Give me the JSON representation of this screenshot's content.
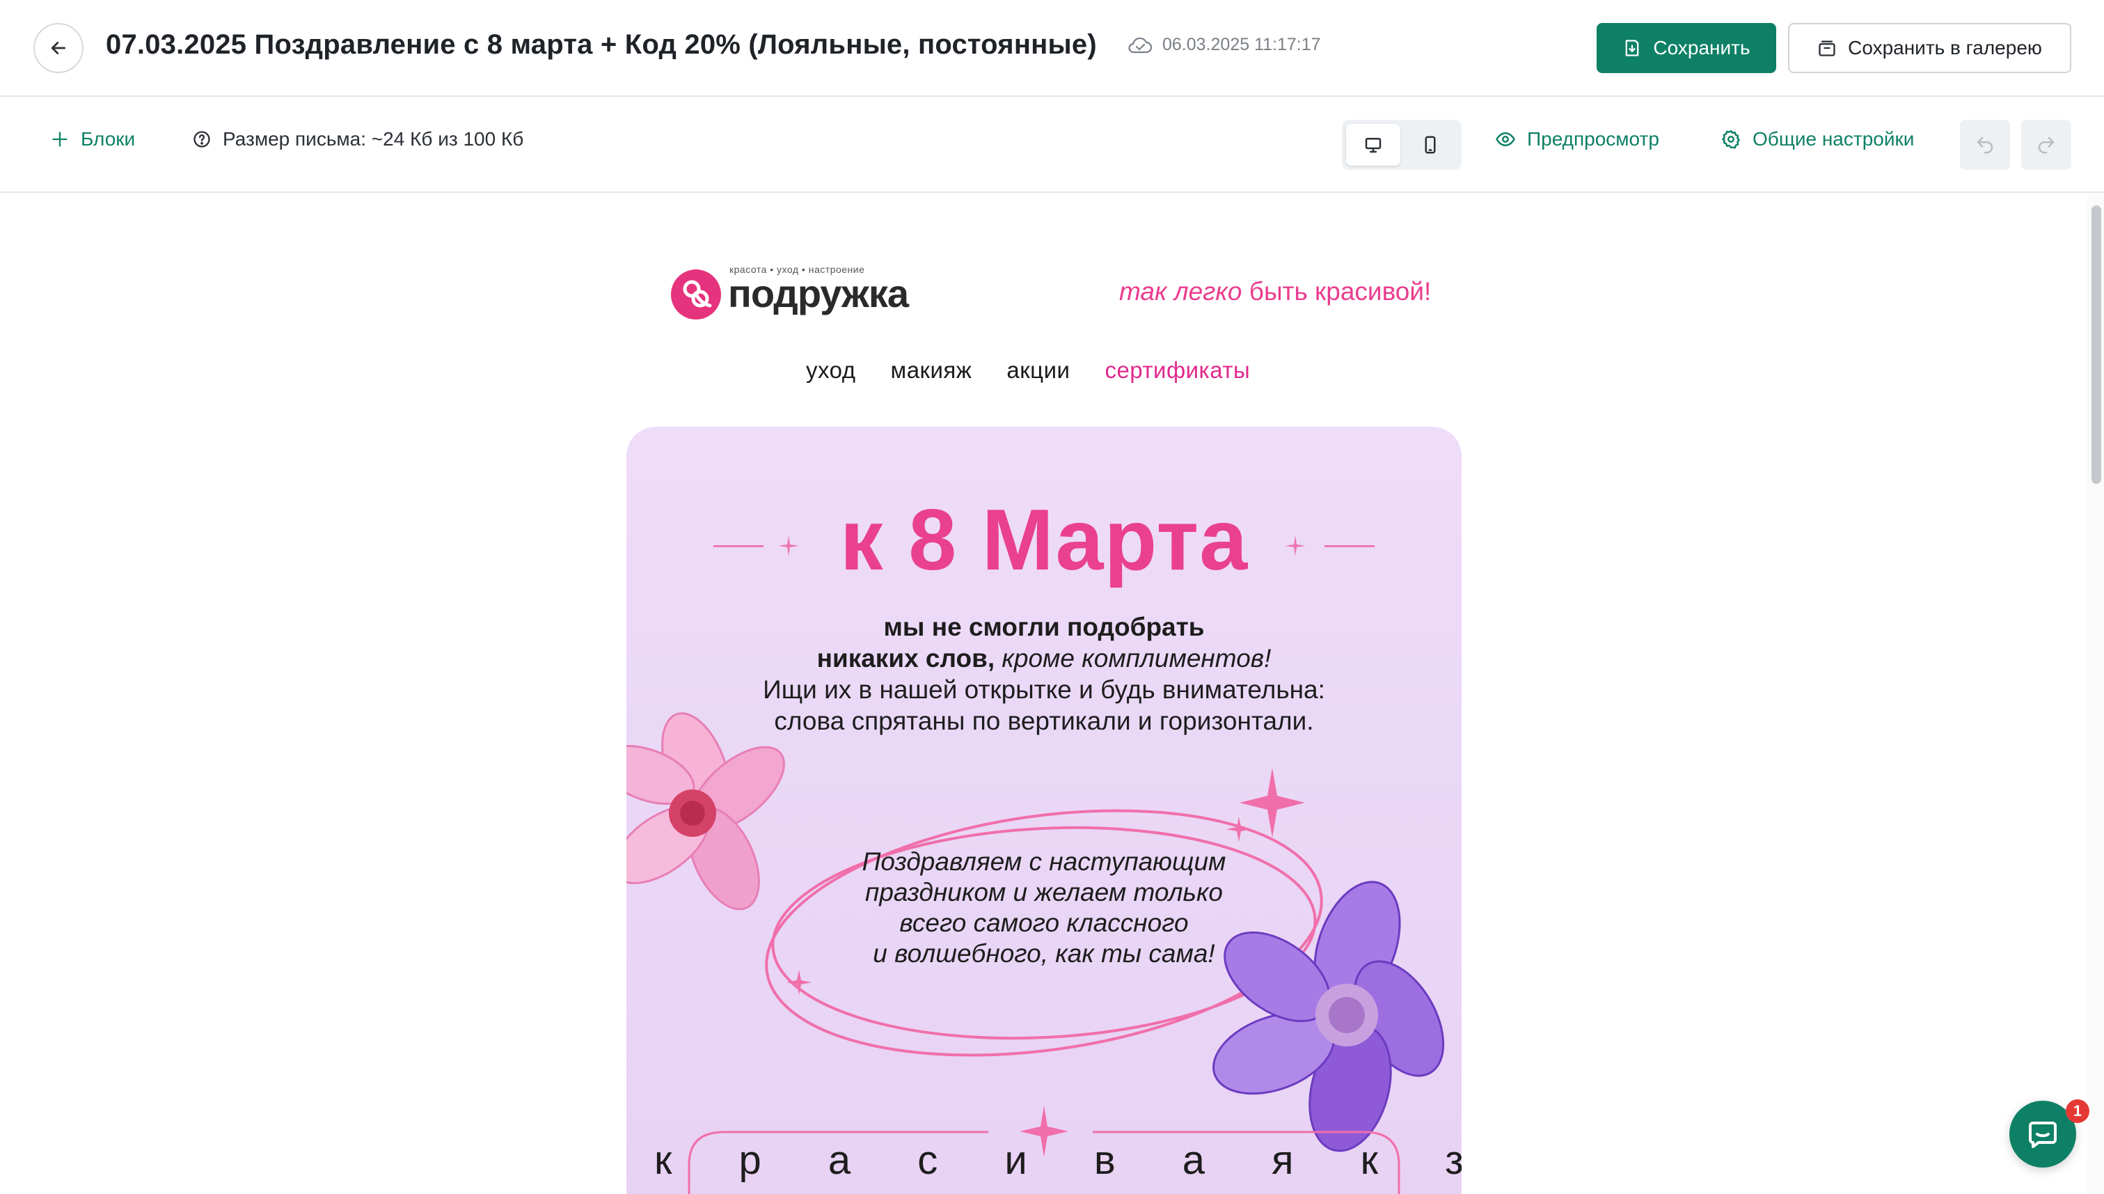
{
  "header": {
    "back_icon": "arrow-left-icon",
    "title": "07.03.2025 Поздравление с 8 марта + Код 20% (Лояльные, постоянные)",
    "saved_icon": "cloud-check-icon",
    "saved_at": "06.03.2025 11:17:17",
    "save_label": "Сохранить",
    "save_to_gallery_label": "Сохранить в галерею"
  },
  "toolbar": {
    "blocks_label": "Блоки",
    "size_label": "Размер письма: ~24 Кб из 100 Кб",
    "desktop_icon": "monitor-icon",
    "mobile_icon": "phone-icon",
    "active_device": "desktop",
    "preview_label": "Предпросмотр",
    "settings_label": "Общие настройки",
    "undo_icon": "undo-icon",
    "redo_icon": "redo-icon"
  },
  "email": {
    "logo": {
      "tagline": "красота • уход • настроение",
      "wordmark": "подружка"
    },
    "slogan_italic": "так легко",
    "slogan_rest": " быть красивой!",
    "nav": [
      "уход",
      "макияж",
      "акции",
      "сертификаты"
    ],
    "card": {
      "heading": "к 8 Марта",
      "intro_line1": "мы не смогли подобрать",
      "intro_line2_bold": "никаких слов,",
      "intro_line2_italic": " кроме комплиментов!",
      "intro_line3": "Ищи их в нашей открытке и будь внимательна:",
      "intro_line4": "слова спрятаны по вертикали и горизонтали.",
      "wish_line1": "Поздравляем с наступающим",
      "wish_line2": "праздником и желаем только",
      "wish_line3": "всего самого классного",
      "wish_line4": "и волшебного, как ты сама!",
      "letters_row": "к р а с и в а я к з г с"
    }
  },
  "chat": {
    "icon": "chat-icon",
    "badge": "1"
  },
  "colors": {
    "brand_green": "#0e8066",
    "accent_pink": "#e9408f",
    "card_bg": "#ecdaf8"
  }
}
